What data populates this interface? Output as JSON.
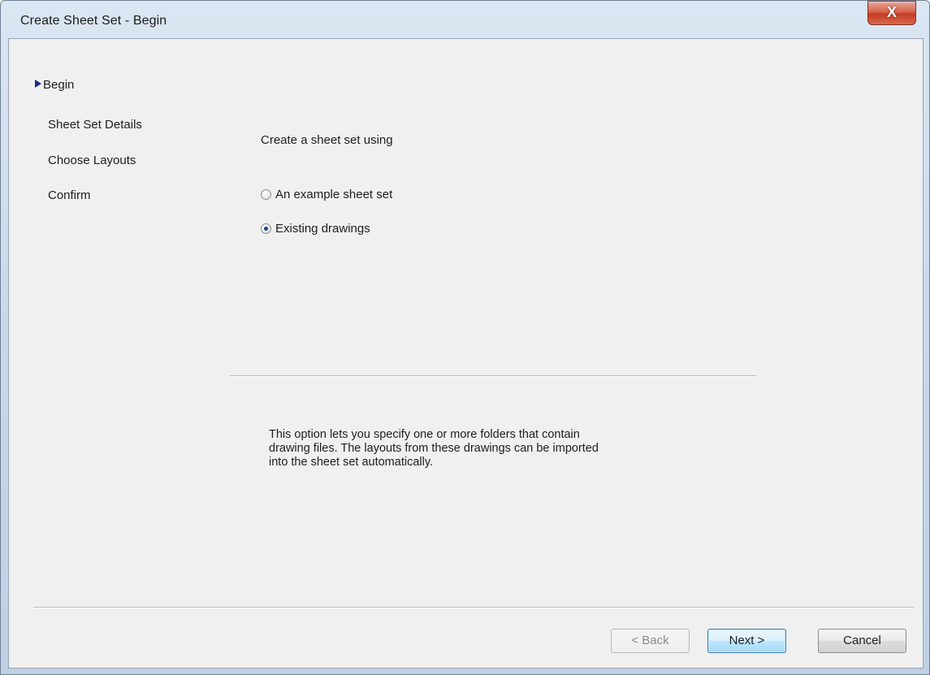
{
  "window": {
    "title": "Create Sheet Set - Begin",
    "close_label": "X"
  },
  "nav": {
    "items": [
      {
        "label": "Begin",
        "active": true
      },
      {
        "label": "Sheet Set Details",
        "active": false
      },
      {
        "label": "Choose Layouts",
        "active": false
      },
      {
        "label": "Confirm",
        "active": false
      }
    ]
  },
  "main": {
    "heading": "Create a sheet set using",
    "options": [
      {
        "label": "An example sheet set",
        "checked": false
      },
      {
        "label": "Existing drawings",
        "checked": true
      }
    ],
    "description_lines": [
      "This option lets you specify one or more folders that contain",
      "drawing files.  The layouts from these drawings can be imported",
      "into the sheet set automatically."
    ]
  },
  "buttons": {
    "back": {
      "label": "< Back",
      "enabled": false
    },
    "next": {
      "label": "Next >",
      "enabled": true
    },
    "cancel": {
      "label": "Cancel",
      "enabled": true
    }
  },
  "colors": {
    "nav_arrow": "#1f2a8a",
    "client_bg": "#f0f0f0",
    "close_button": "#c43b22",
    "default_button_border": "#3c7fb1"
  }
}
